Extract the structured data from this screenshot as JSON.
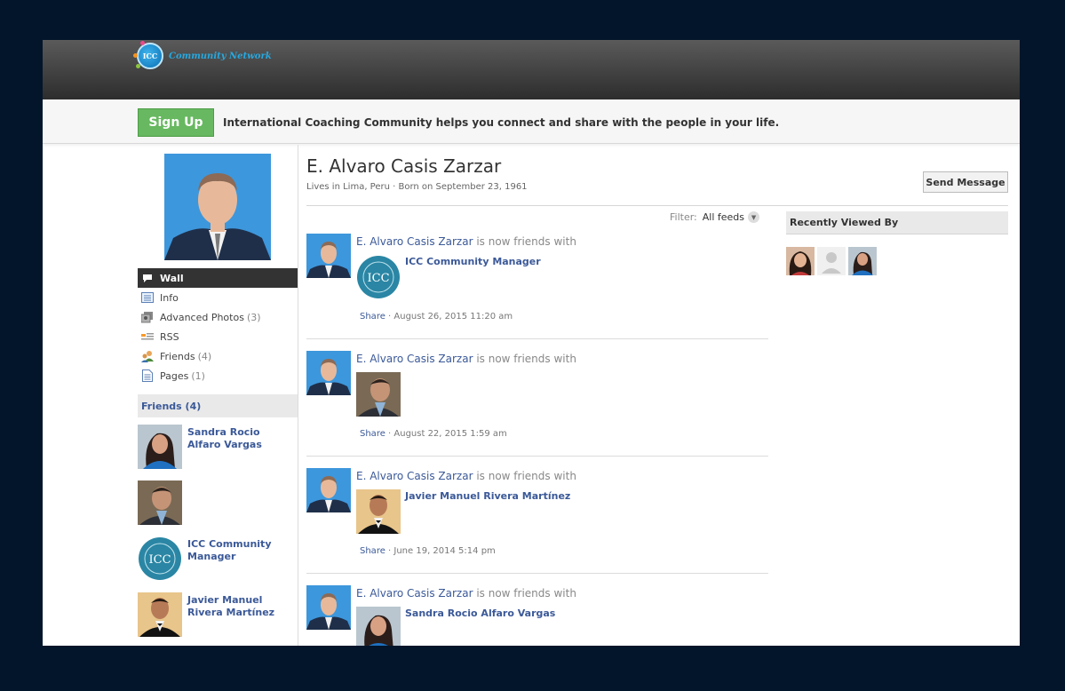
{
  "brand": {
    "logo_text": "ICC",
    "name": "Community Network"
  },
  "signbar": {
    "signup_label": "Sign Up",
    "tagline": "International Coaching Community helps you connect and share with the people in your life."
  },
  "profile": {
    "name": "E. Alvaro Casis Zarzar",
    "subinfo": "Lives in Lima, Peru · Born on September 23, 1961",
    "send_message": "Send Message"
  },
  "menu": [
    {
      "label": "Wall",
      "count": "",
      "icon": "wall-icon"
    },
    {
      "label": "Info",
      "count": "",
      "icon": "info-icon"
    },
    {
      "label": "Advanced Photos",
      "count": "(3)",
      "icon": "photos-icon"
    },
    {
      "label": "RSS",
      "count": "",
      "icon": "rss-icon"
    },
    {
      "label": "Friends",
      "count": "(4)",
      "icon": "friends-icon"
    },
    {
      "label": "Pages",
      "count": "(1)",
      "icon": "pages-icon"
    }
  ],
  "friends": {
    "heading": "Friends (4)",
    "items": [
      {
        "name": "Sandra Rocio Alfaro Vargas"
      },
      {
        "name": ""
      },
      {
        "name": "ICC Community Manager"
      },
      {
        "name": "Javier Manuel Rivera Martínez"
      }
    ]
  },
  "filter": {
    "label": "Filter:",
    "value": "All feeds"
  },
  "feed": [
    {
      "actor": "E. Alvaro Casis Zarzar",
      "action": " is now friends with",
      "friend": "ICC Community Manager",
      "share": "Share",
      "date": " · August 26, 2015 11:20 am"
    },
    {
      "actor": "E. Alvaro Casis Zarzar",
      "action": " is now friends with",
      "friend": "",
      "share": "Share",
      "date": " · August 22, 2015 1:59 am"
    },
    {
      "actor": "E. Alvaro Casis Zarzar",
      "action": " is now friends with",
      "friend": "Javier Manuel Rivera Martínez",
      "share": "Share",
      "date": " · June 19, 2014 5:14 pm"
    },
    {
      "actor": "E. Alvaro Casis Zarzar",
      "action": " is now friends with",
      "friend": "Sandra Rocio Alfaro Vargas",
      "share": "",
      "date": ""
    }
  ],
  "recently_viewed": {
    "heading": "Recently Viewed By"
  },
  "colors": {
    "accent": "#3b5998",
    "signup": "#67b860",
    "topbar": "#3a3a3a"
  }
}
